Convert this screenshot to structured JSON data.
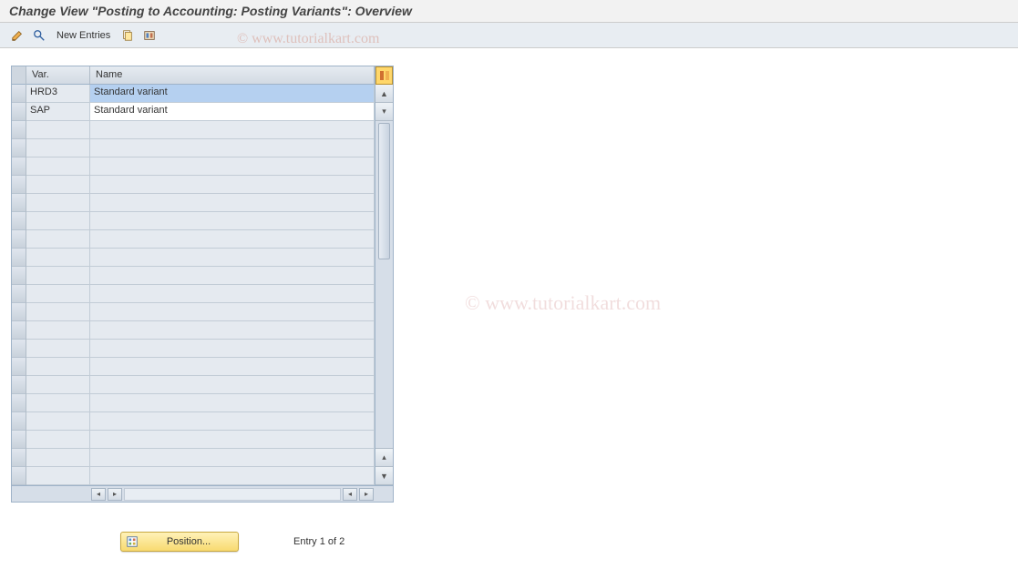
{
  "title": "Change View \"Posting to Accounting: Posting Variants\": Overview",
  "toolbar": {
    "new_entries": "New Entries"
  },
  "watermark": "© www.tutorialkart.com",
  "table": {
    "columns": {
      "var": "Var.",
      "name": "Name"
    },
    "rows": [
      {
        "var": "HRD3",
        "name": "Standard variant",
        "selected": true
      },
      {
        "var": "SAP",
        "name": "Standard variant",
        "selected": false
      }
    ],
    "empty_rows": 20
  },
  "footer": {
    "position_btn": "Position...",
    "entry_info": "Entry 1 of 2"
  }
}
